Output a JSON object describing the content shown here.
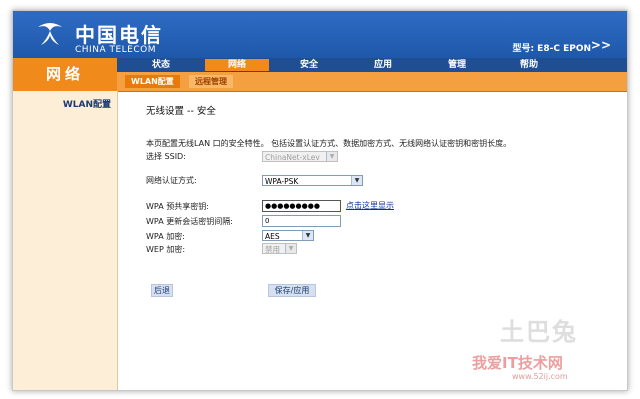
{
  "brand": {
    "name_cn": "中国电信",
    "name_en": "CHINA TELECOM",
    "logo_icon": "china-telecom-logo-icon"
  },
  "header": {
    "model": "型号: E8-C EPON",
    "more": ">>"
  },
  "section_tile": "网络",
  "nav": {
    "items": [
      "状态",
      "网络",
      "安全",
      "应用",
      "管理",
      "帮助"
    ],
    "active": "网络"
  },
  "subnav": {
    "items": [
      "WLAN配置",
      "远程管理"
    ],
    "active": "WLAN配置"
  },
  "sidebar": {
    "items": [
      "WLAN配置"
    ]
  },
  "page": {
    "title": "无线设置  -- 安全",
    "description": "本页配置无线LAN 口的安全特性。 包括设置认证方式、数据加密方式、无线网络认证密钥和密钥长度。",
    "ssid_label": "选择  SSID:",
    "ssid_value": "ChinaNet-xLev",
    "auth_label": "网络认证方式:",
    "auth_value": "WPA-PSK",
    "psk_label": "WPA 预共享密钥:",
    "psk_value": "●●●●●●●●●",
    "show_link": "点击这里显示",
    "rekey_label": "WPA 更新会话密钥间隔:",
    "rekey_value": "0",
    "wpa_enc_label": "WPA 加密:",
    "wpa_enc_value": "AES",
    "wep_label": "WEP 加密:",
    "wep_value": "禁用",
    "back_button": "后退",
    "save_button": "保存/应用"
  },
  "watermark": {
    "line1": "土巴兔",
    "line2": "我爱IT技术网",
    "line3": "www.52ij.com"
  },
  "colors": {
    "header_blue": "#1f58aa",
    "nav_navy": "#1f4f92",
    "accent_orange": "#f08a1a",
    "sidebar_bg": "#fdeed8"
  }
}
